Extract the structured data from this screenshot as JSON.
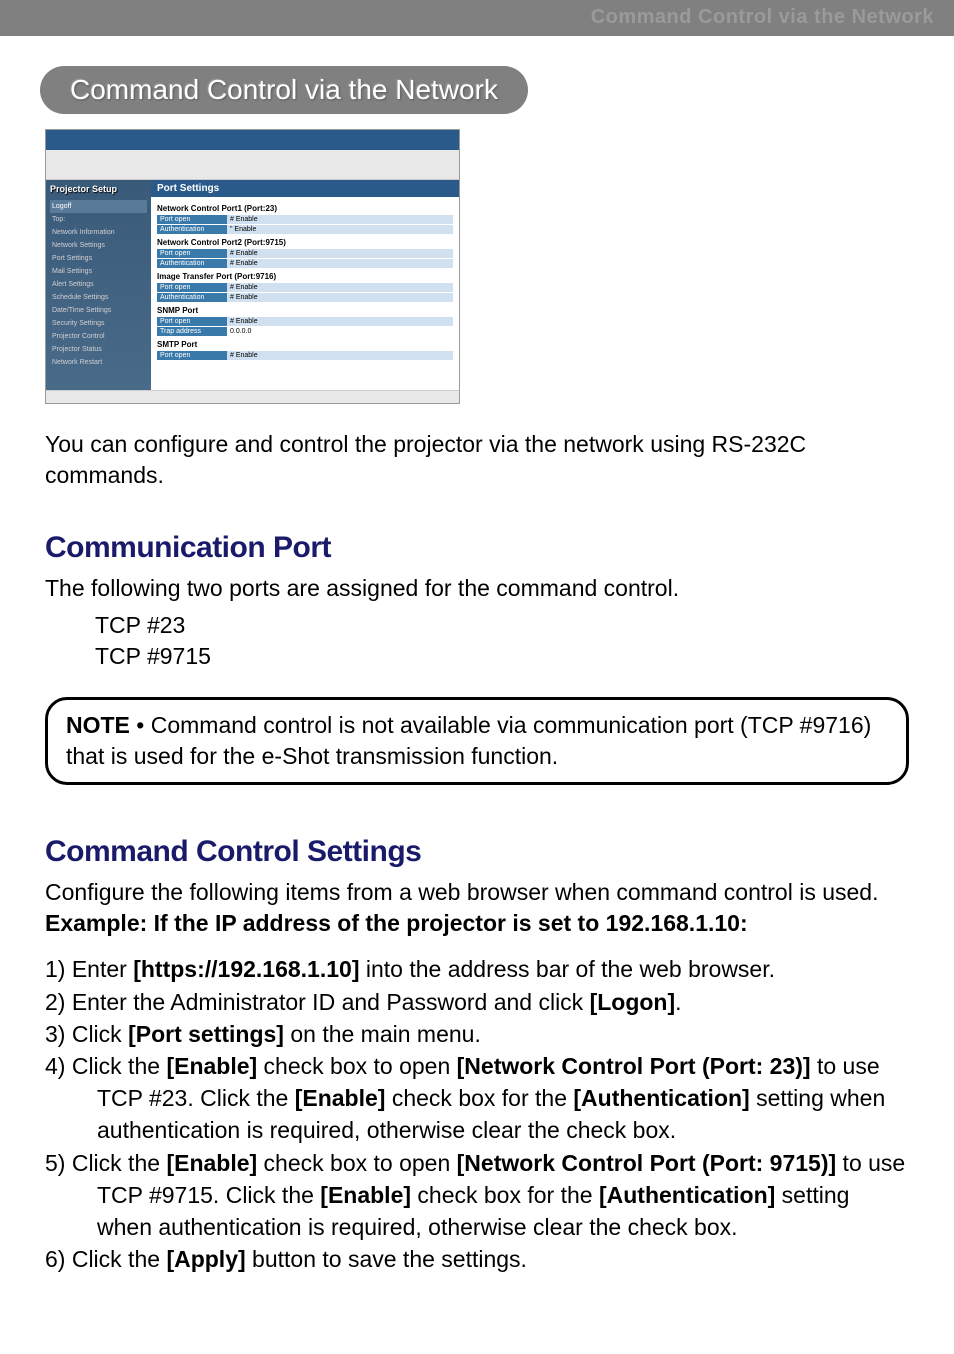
{
  "header": {
    "bar_text": "Command Control via the Network"
  },
  "pill_heading": "Command Control via the Network",
  "thumb": {
    "sidebar_title": "Projector Setup",
    "main_header": "Port Settings",
    "section1_label": "Network Control Port1 (Port:23)",
    "port_open": "Port open",
    "auth": "Authentication",
    "enable_chk": "# Enable",
    "enable_opt": "\" Enable",
    "section2_label": "Network Control Port2 (Port:9715)",
    "section3_label": "Image Transfer Port (Port:9716)",
    "snmp_label": "SNMP Port",
    "smtp_label": "SMTP Port",
    "trap_addr": "Trap address",
    "trap_val": "0.0.0.0",
    "sidebar_items": [
      "Logoff",
      "Top:",
      "Network Information",
      "Network Settings",
      "Port Settings",
      "Mail Settings",
      "Alert Settings",
      "Schedule Settings",
      "Date/Time Settings",
      "Security Settings",
      "Projector Control",
      "Projector Status",
      "Network Restart"
    ]
  },
  "intro_text": "You can configure and control the projector via the network using RS-232C commands.",
  "section1": {
    "heading": "Communication Port",
    "text": "The following two ports are assigned for the command control.",
    "port1": "TCP #23",
    "port2": "TCP #9715"
  },
  "note": {
    "label": "NOTE",
    "text": " • Command control is not available via communication port (TCP #9716) that is used for the e-Shot transmission function."
  },
  "section2": {
    "heading": "Command Control Settings",
    "intro": "Configure the following items from a web browser when command control is used.",
    "example_label": "Example: If the IP address of the projector is set to 192.168.1.10:",
    "steps": {
      "s1_pre": "1) Enter ",
      "s1_bold": "[https://192.168.1.10]",
      "s1_post": " into the address bar of the web browser.",
      "s2_pre": "2) Enter the Administrator ID and Password and click ",
      "s2_bold": "[Logon]",
      "s2_post": ".",
      "s3_pre": "3) Click ",
      "s3_bold": "[Port settings]",
      "s3_post": " on the main menu.",
      "s4_pre": "4) Click the ",
      "s4_bold1": "[Enable]",
      "s4_mid1": " check box to open ",
      "s4_bold2": "[Network Control Port (Port: 23)]",
      "s4_mid2": " to use TCP #23. Click the ",
      "s4_bold3": "[Enable]",
      "s4_mid3": " check box for the ",
      "s4_bold4": "[Authentication]",
      "s4_post": " setting when authentication is required, otherwise clear the check box.",
      "s5_pre": "5) Click the ",
      "s5_bold1": "[Enable]",
      "s5_mid1": " check box to open ",
      "s5_bold2": "[Network Control Port (Port: 9715)]",
      "s5_mid2": " to use TCP #9715. Click the ",
      "s5_bold3": "[Enable]",
      "s5_mid3": " check box for the ",
      "s5_bold4": "[Authentication]",
      "s5_post": " setting when authentication is required, otherwise clear the check box.",
      "s6_pre": "6) Click the ",
      "s6_bold": "[Apply]",
      "s6_post": " button to save the settings."
    }
  }
}
